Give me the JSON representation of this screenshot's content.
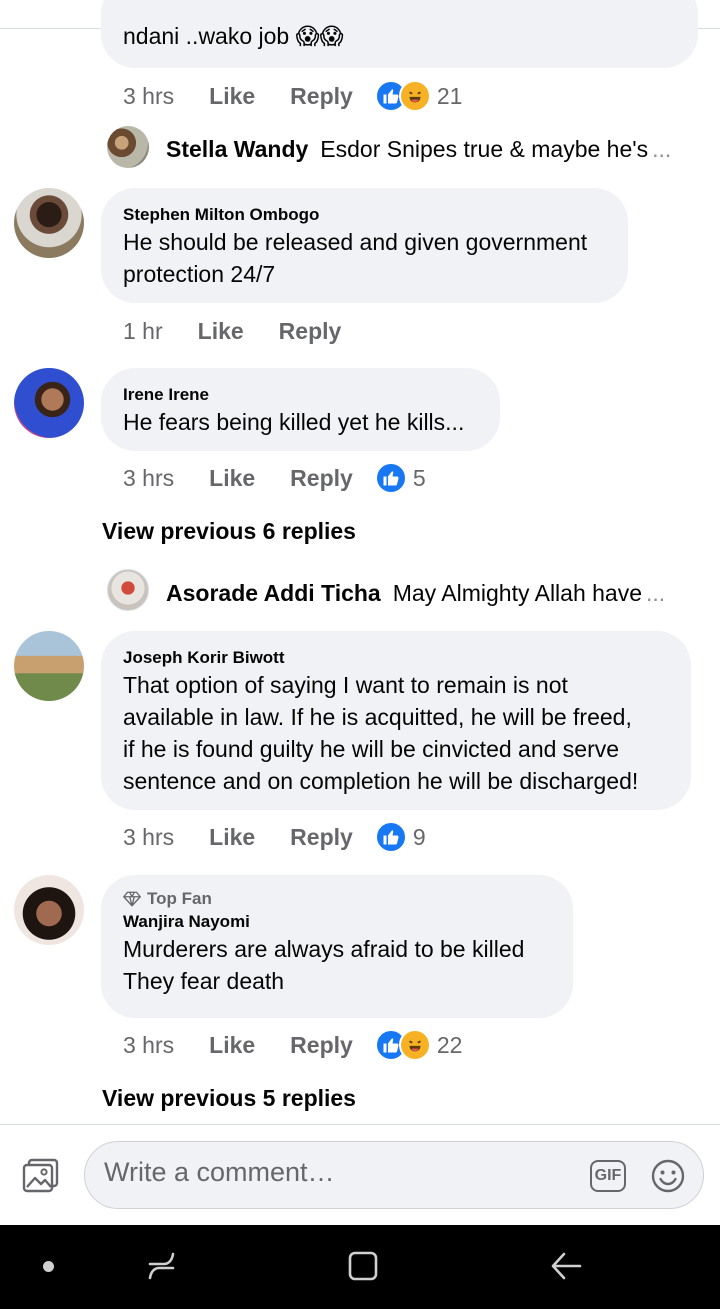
{
  "top_comment": {
    "text": "ndani ..wako job 😱😱",
    "time": "3 hrs",
    "like": "Like",
    "reply": "Reply",
    "reaction_count": "21"
  },
  "reply_preview_1": {
    "name": "Stella Wandy",
    "text": "Esdor Snipes true & maybe he's",
    "ellipsis": "..."
  },
  "comments": [
    {
      "name": "Stephen Milton Ombogo",
      "lines": [
        "He should be released and given government",
        "protection 24/7"
      ],
      "time": "1 hr",
      "like": "Like",
      "reply": "Reply"
    },
    {
      "name": "Irene Irene",
      "lines": [
        "He fears being killed yet he kills..."
      ],
      "time": "3 hrs",
      "like": "Like",
      "reply": "Reply",
      "reaction_count": "5"
    },
    {
      "name": "Joseph Korir Biwott",
      "lines": [
        "That option of saying I want to remain is not",
        "available in law. If  he is acquitted,  he will be freed,",
        "if he is found guilty he will be cinvicted and serve",
        "sentence and on completion he will be discharged!"
      ],
      "time": "3 hrs",
      "like": "Like",
      "reply": "Reply",
      "reaction_count": "9"
    },
    {
      "badge": "Top Fan",
      "name": "Wanjira Nayomi",
      "lines": [
        "Murderers are always afraid to be killed",
        "They fear death"
      ],
      "time": "3 hrs",
      "like": "Like",
      "reply": "Reply",
      "reaction_count": "22"
    }
  ],
  "view_previous_1": "View previous 6 replies",
  "reply_preview_2": {
    "name": "Asorade Addi Ticha",
    "text": "May Almighty Allah have",
    "ellipsis": "..."
  },
  "view_previous_2": "View previous 5 replies",
  "composer": {
    "placeholder": "Write a comment…",
    "gif_label": "GIF"
  },
  "colors": {
    "like_blue": "#1877f2",
    "haha_yellow": "#f7b125",
    "bubble_bg": "#f0f2f5",
    "meta_gray": "#65676b"
  }
}
